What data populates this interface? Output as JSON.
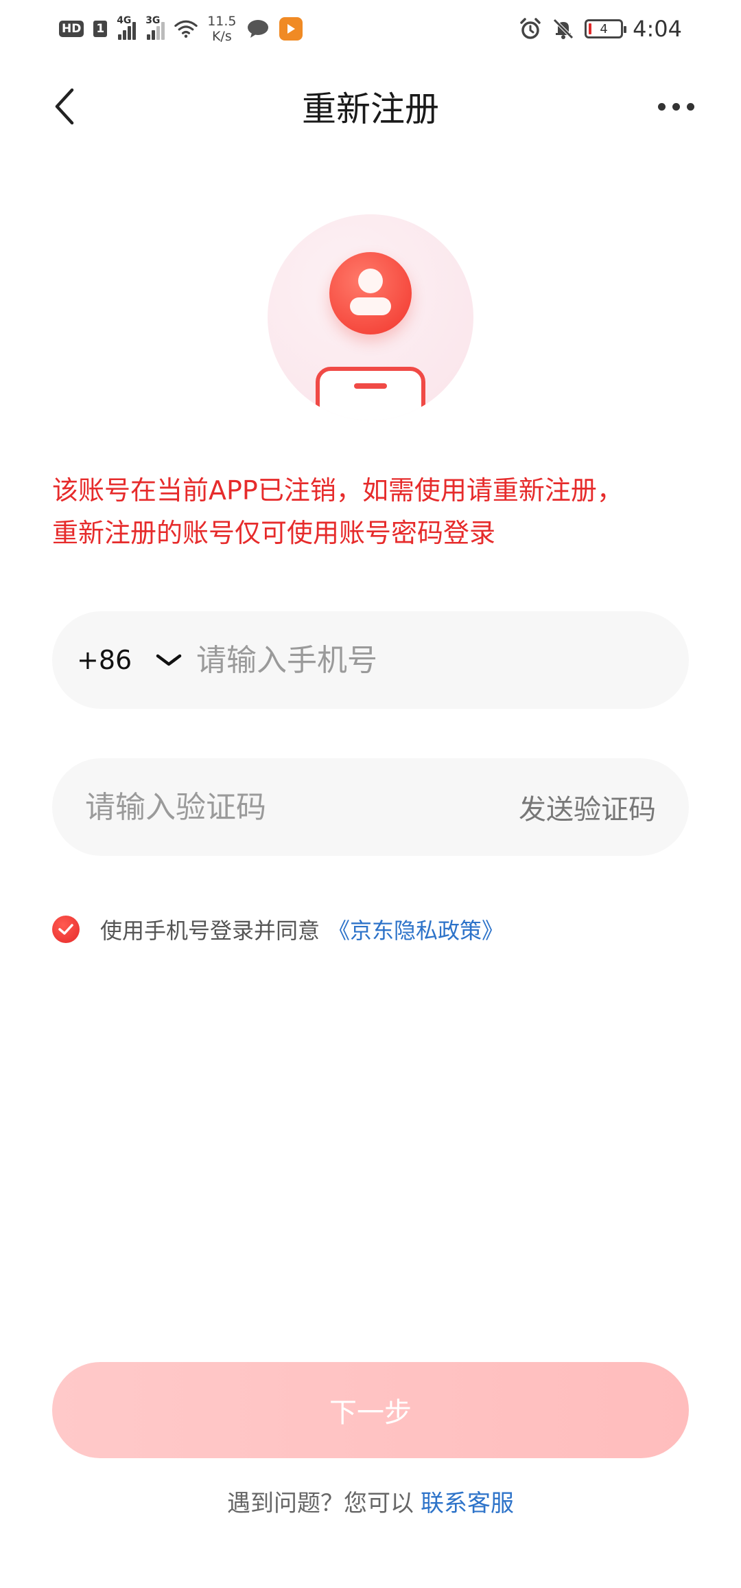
{
  "status_bar": {
    "hd_badge": "HD",
    "sim_badge": "1",
    "network_1": "4G",
    "network_2": "3G",
    "speed_value": "11.5",
    "speed_unit": "K/s",
    "battery": "4",
    "time": "4:04",
    "icons": [
      "wifi-icon",
      "wechat-icon",
      "app-notify-icon",
      "alarm-icon",
      "mute-icon",
      "battery-icon"
    ]
  },
  "nav": {
    "title": "重新注册",
    "back_icon": "back-chevron-icon",
    "more_icon": "more-dots-icon"
  },
  "warning": {
    "line1": "该账号在当前APP已注销，如需使用请重新注册，",
    "line2": "重新注册的账号仅可使用账号密码登录"
  },
  "phone_field": {
    "country_code": "+86",
    "value": "",
    "placeholder": "请输入手机号"
  },
  "code_field": {
    "value": "",
    "placeholder": "请输入验证码",
    "send_label": "发送验证码"
  },
  "agreement": {
    "checked": true,
    "text": "使用手机号登录并同意",
    "link": "《京东隐私政策》"
  },
  "next_button": {
    "label": "下一步",
    "enabled": false
  },
  "help": {
    "text": "遇到问题？您可以",
    "link": "联系客服"
  },
  "colors": {
    "accent_red": "#e62b2b",
    "link_blue": "#2d73c9",
    "button_disabled": "#ffc4c4",
    "field_bg": "#f7f7f7"
  }
}
